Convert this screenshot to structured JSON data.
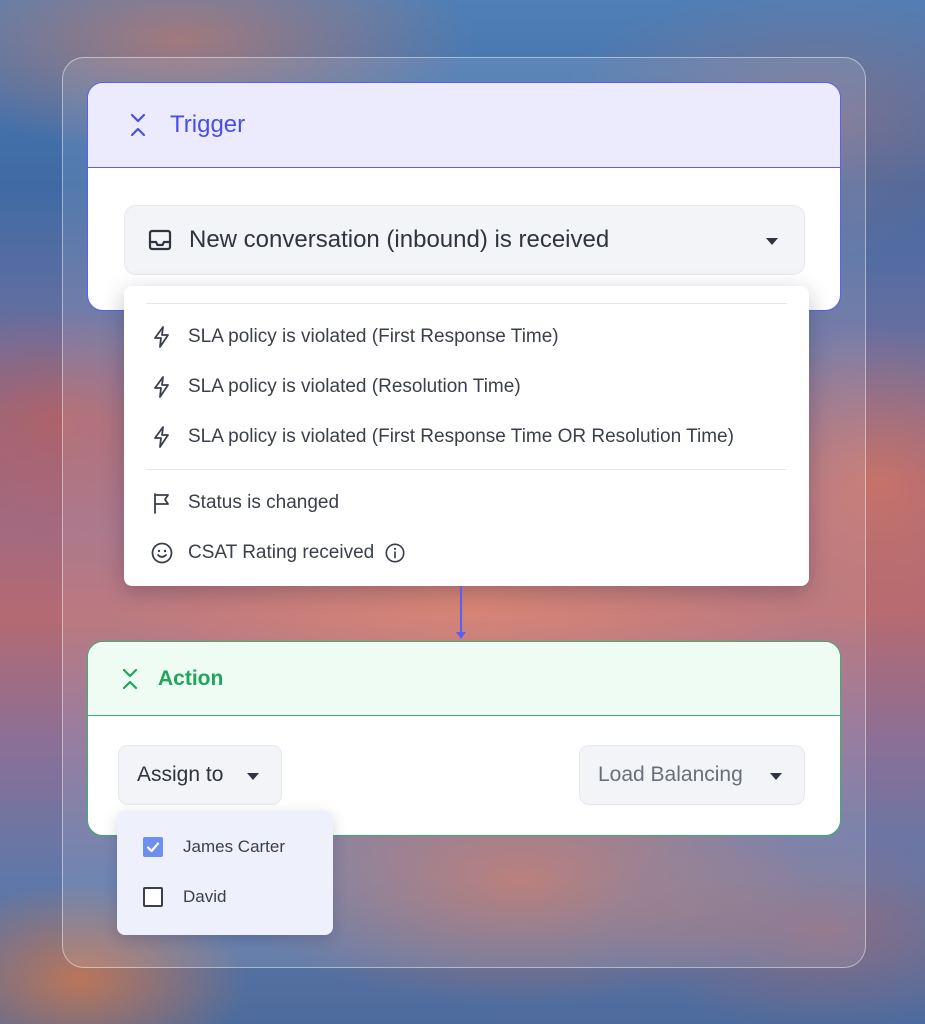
{
  "trigger": {
    "title": "Trigger",
    "selected": "New conversation (inbound) is received",
    "options": [
      {
        "label": "SLA policy is violated (First Response Time)",
        "icon": "lightning-icon"
      },
      {
        "label": "SLA policy is violated (Resolution Time)",
        "icon": "lightning-icon"
      },
      {
        "label": "SLA policy is violated (First Response Time OR Resolution Time)",
        "icon": "lightning-icon"
      },
      {
        "label": "Status is changed",
        "icon": "flag-icon"
      },
      {
        "label": "CSAT Rating received",
        "icon": "smiley-icon"
      }
    ]
  },
  "action": {
    "title": "Action",
    "assign_label": "Assign to",
    "method_label": "Load Balancing",
    "assignees": [
      {
        "name": "James Carter",
        "checked": true
      },
      {
        "name": "David",
        "checked": false
      }
    ]
  },
  "colors": {
    "trigger_accent": "#5b5ef0",
    "action_accent": "#37b26a",
    "checkbox_checked": "#6f8ff0"
  }
}
